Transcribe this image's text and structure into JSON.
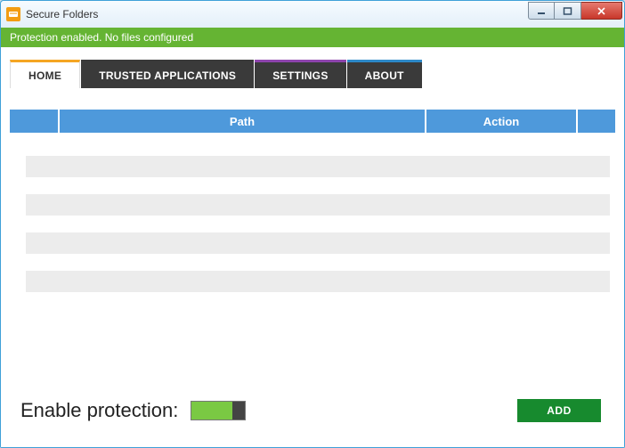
{
  "window": {
    "title": "Secure Folders"
  },
  "status": {
    "text": "Protection enabled. No files configured"
  },
  "tabs": {
    "home": "HOME",
    "trusted": "TRUSTED APPLICATIONS",
    "settings": "SETTINGS",
    "about": "ABOUT",
    "active": "home"
  },
  "table": {
    "headers": {
      "path": "Path",
      "action": "Action"
    },
    "rows": [
      "",
      "",
      "",
      ""
    ]
  },
  "footer": {
    "enable_label": "Enable protection:",
    "protection_enabled": true,
    "add_label": "ADD"
  },
  "colors": {
    "status_green": "#65b433",
    "tab_dark": "#3a3a3a",
    "tab_active_accent": "#f5a623",
    "header_blue": "#4e99db",
    "add_button": "#178a2e",
    "toggle_on": "#7ac943"
  }
}
